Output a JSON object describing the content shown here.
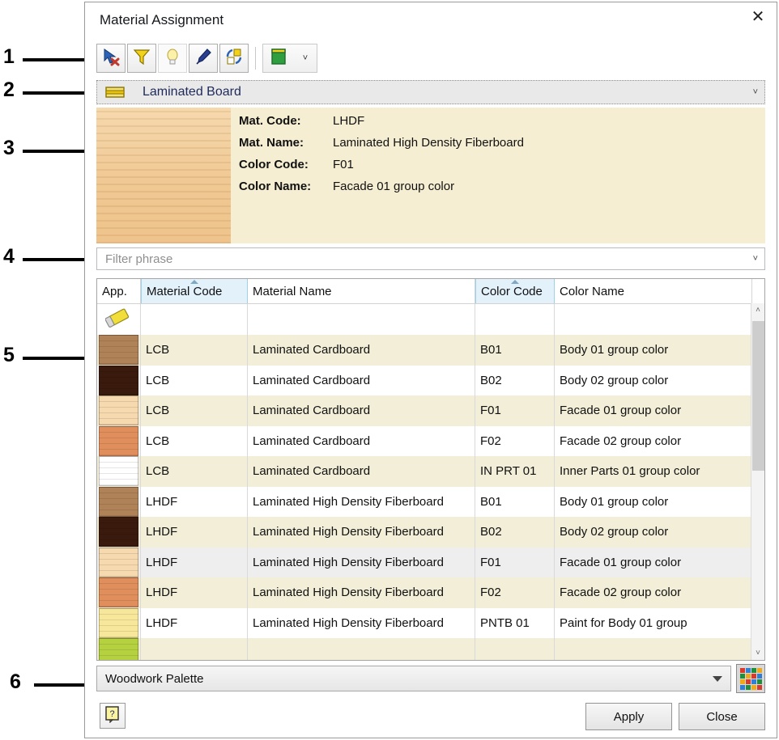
{
  "window": {
    "title": "Material Assignment",
    "close_label": "✕"
  },
  "callouts": [
    {
      "num": "1"
    },
    {
      "num": "2"
    },
    {
      "num": "3"
    },
    {
      "num": "4"
    },
    {
      "num": "5"
    },
    {
      "num": "6"
    }
  ],
  "toolbar": {
    "buttons": [
      {
        "name": "clear-selection-icon",
        "tooltip": "Clear selection"
      },
      {
        "name": "filter-icon",
        "tooltip": "Filter"
      },
      {
        "name": "bulb-icon",
        "tooltip": "Highlight"
      },
      {
        "name": "eyedropper-icon",
        "tooltip": "Pick material"
      },
      {
        "name": "replace-icon",
        "tooltip": "Replace"
      }
    ],
    "split": {
      "icon": "board-icon",
      "arrow": "˅"
    }
  },
  "material_combo": {
    "label": "Laminated Board",
    "arrow": "˅",
    "icon": "board-swatch-icon"
  },
  "info_panel": {
    "preview_color": "#f2cfa0",
    "rows": [
      {
        "key": "Mat. Code:",
        "value": "LHDF"
      },
      {
        "key": "Mat. Name:",
        "value": "Laminated High Density Fiberboard"
      },
      {
        "key": "Color Code:",
        "value": "F01"
      },
      {
        "key": "Color Name:",
        "value": "Facade 01 group color"
      }
    ]
  },
  "filter": {
    "placeholder": "Filter phrase",
    "value": "",
    "arrow": "˅"
  },
  "table": {
    "columns": [
      {
        "key": "app",
        "label": "App.",
        "sorted": false
      },
      {
        "key": "mcode",
        "label": "Material Code",
        "sorted": true
      },
      {
        "key": "mname",
        "label": "Material Name",
        "sorted": false
      },
      {
        "key": "ccode",
        "label": "Color Code",
        "sorted": true
      },
      {
        "key": "cname",
        "label": "Color Name",
        "sorted": false
      }
    ],
    "eraser_row": {
      "icon": "eraser-icon"
    },
    "rows": [
      {
        "swatch": "#b08258",
        "mcode": "LCB",
        "mname": "Laminated Cardboard",
        "ccode": "B01",
        "cname": "Body 01 group color",
        "style": "alt"
      },
      {
        "swatch": "#3a1a0d",
        "mcode": "LCB",
        "mname": "Laminated Cardboard",
        "ccode": "B02",
        "cname": "Body 02 group color",
        "style": "plain"
      },
      {
        "swatch": "#f6d9ae",
        "mcode": "LCB",
        "mname": "Laminated Cardboard",
        "ccode": "F01",
        "cname": "Facade 01 group color",
        "style": "alt"
      },
      {
        "swatch": "#e08e5c",
        "mcode": "LCB",
        "mname": "Laminated Cardboard",
        "ccode": "F02",
        "cname": "Facade 02 group color",
        "style": "plain"
      },
      {
        "swatch": "#ffffff",
        "mcode": "LCB",
        "mname": "Laminated Cardboard",
        "ccode": "IN PRT 01",
        "cname": "Inner Parts 01 group color",
        "style": "alt"
      },
      {
        "swatch": "#b08258",
        "mcode": "LHDF",
        "mname": "Laminated High Density Fiberboard",
        "ccode": "B01",
        "cname": "Body 01 group color",
        "style": "plain"
      },
      {
        "swatch": "#3a1a0d",
        "mcode": "LHDF",
        "mname": "Laminated High Density Fiberboard",
        "ccode": "B02",
        "cname": "Body 02 group color",
        "style": "alt"
      },
      {
        "swatch": "#f6d9ae",
        "mcode": "LHDF",
        "mname": "Laminated High Density Fiberboard",
        "ccode": "F01",
        "cname": "Facade 01 group color",
        "style": "sel"
      },
      {
        "swatch": "#e08e5c",
        "mcode": "LHDF",
        "mname": "Laminated High Density Fiberboard",
        "ccode": "F02",
        "cname": "Facade 02 group color",
        "style": "alt"
      },
      {
        "swatch": "#f7e79a",
        "mcode": "LHDF",
        "mname": "Laminated High Density Fiberboard",
        "ccode": "PNTB 01",
        "cname": "Paint for Body 01 group",
        "style": "plain"
      },
      {
        "swatch": "#b5d13f",
        "mcode": "",
        "mname": "",
        "ccode": "",
        "cname": "",
        "style": "alt"
      }
    ],
    "scroll": {
      "up": "˄",
      "down": "˅"
    }
  },
  "palette": {
    "label": "Woodwork Palette",
    "grid_icon": "color-grid-icon",
    "grid_colors": [
      "#d93a2b",
      "#2f7ed8",
      "#1f8f3d",
      "#f0a91b",
      "#1f8f3d",
      "#f0a91b",
      "#d93a2b",
      "#2f7ed8",
      "#f0a91b",
      "#d93a2b",
      "#2f7ed8",
      "#1f8f3d",
      "#2f7ed8",
      "#1f8f3d",
      "#f0a91b",
      "#d93a2b"
    ]
  },
  "footer": {
    "help_icon": "help-icon",
    "apply_label": "Apply",
    "close_label": "Close"
  }
}
